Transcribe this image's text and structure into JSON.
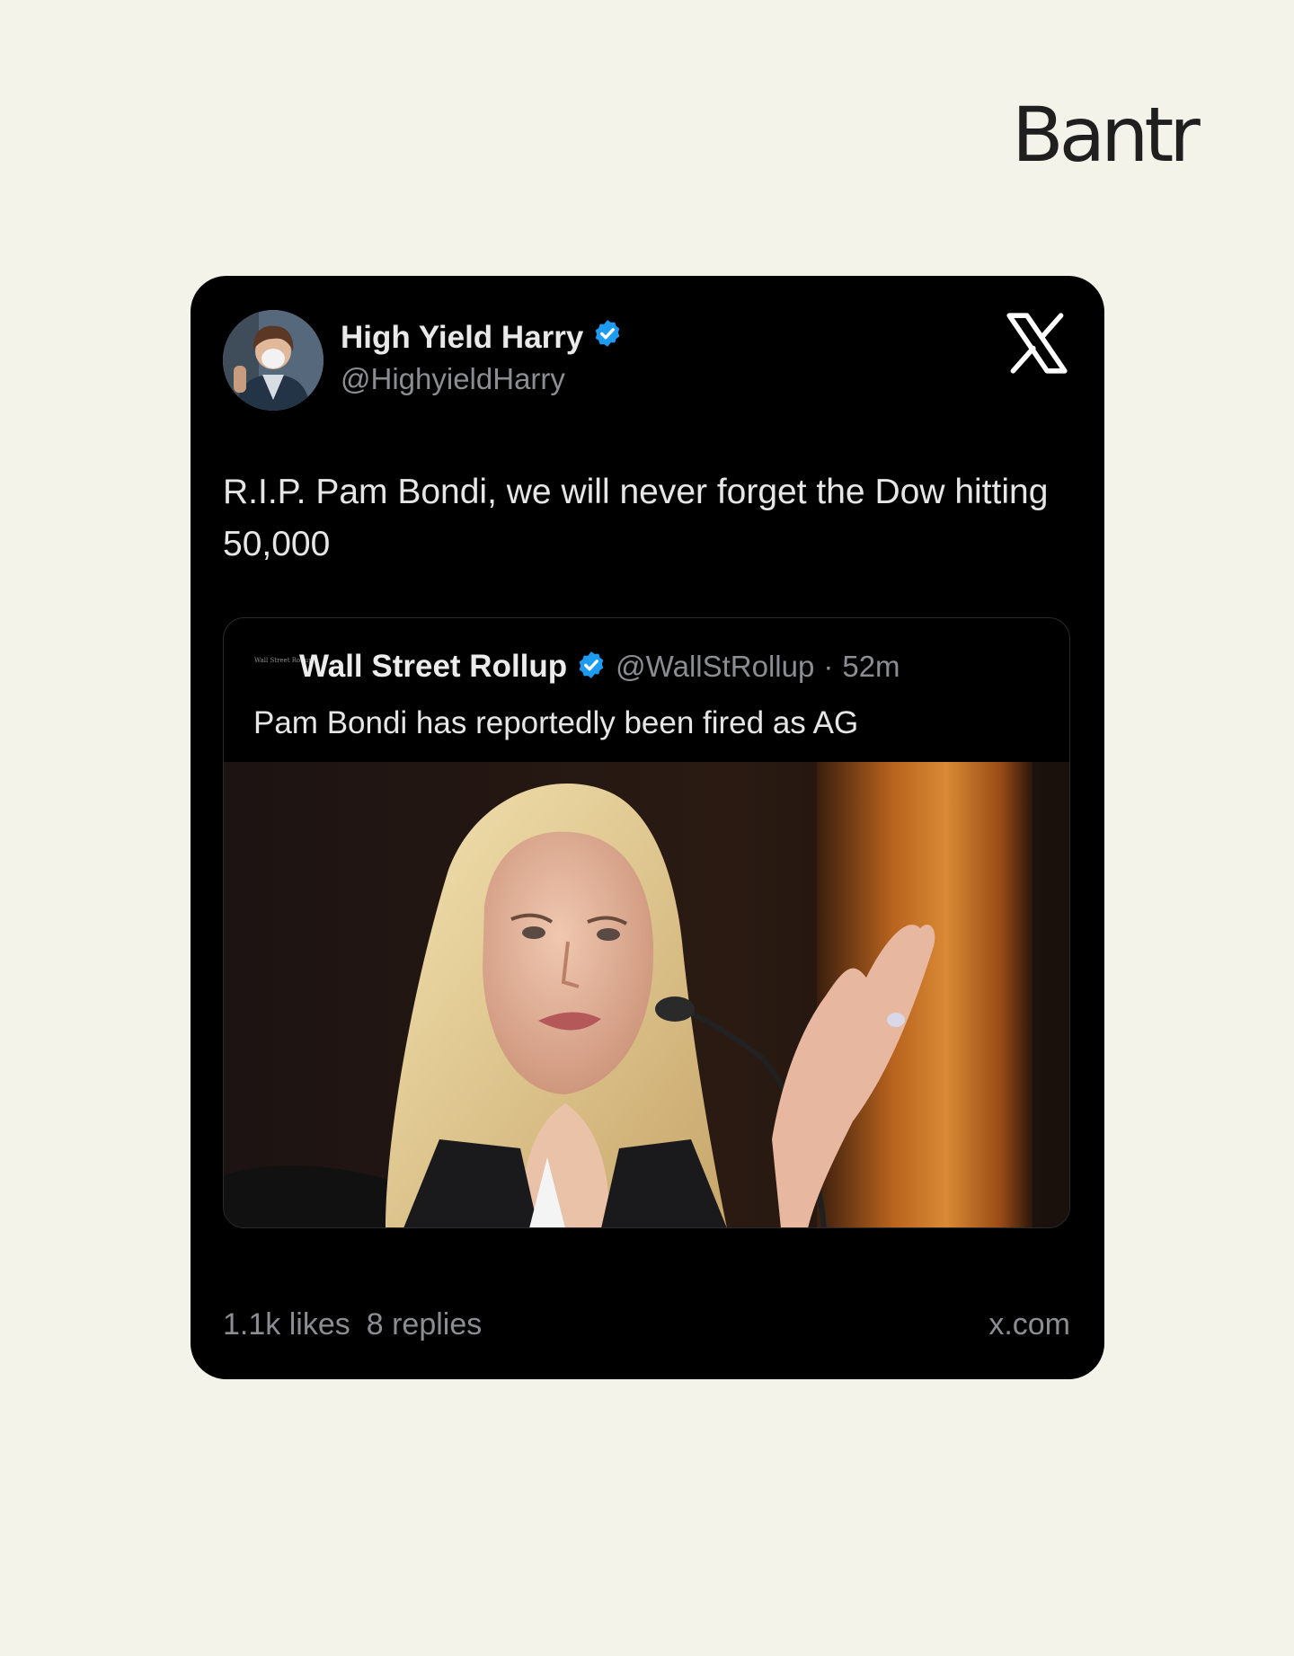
{
  "brand": {
    "logo_text": "Bantr"
  },
  "tweet": {
    "author": {
      "name": "High Yield Harry",
      "handle": "@HighyieldHarry",
      "verified": true,
      "avatar_icon": "person-with-mask-avatar"
    },
    "platform_icon": "x-logo-icon",
    "text": "R.I.P. Pam Bondi, we will never forget the Dow hitting 50,000",
    "quoted": {
      "avatar_text": "Wall Street Rollup",
      "name": "Wall Street Rollup",
      "handle": "@WallStRollup",
      "separator": "·",
      "time": "52m",
      "verified": true,
      "text": "Pam Bondi has reportedly been fired as AG",
      "photo": "woman-speaking-at-microphone-photo"
    },
    "likes": "1.1k likes",
    "replies": "8 replies",
    "domain": "x.com"
  },
  "colors": {
    "page_background": "#f4f3e9",
    "card_background": "#000000",
    "verified_blue": "#1d9bf0",
    "muted_text": "#8b8d92"
  }
}
